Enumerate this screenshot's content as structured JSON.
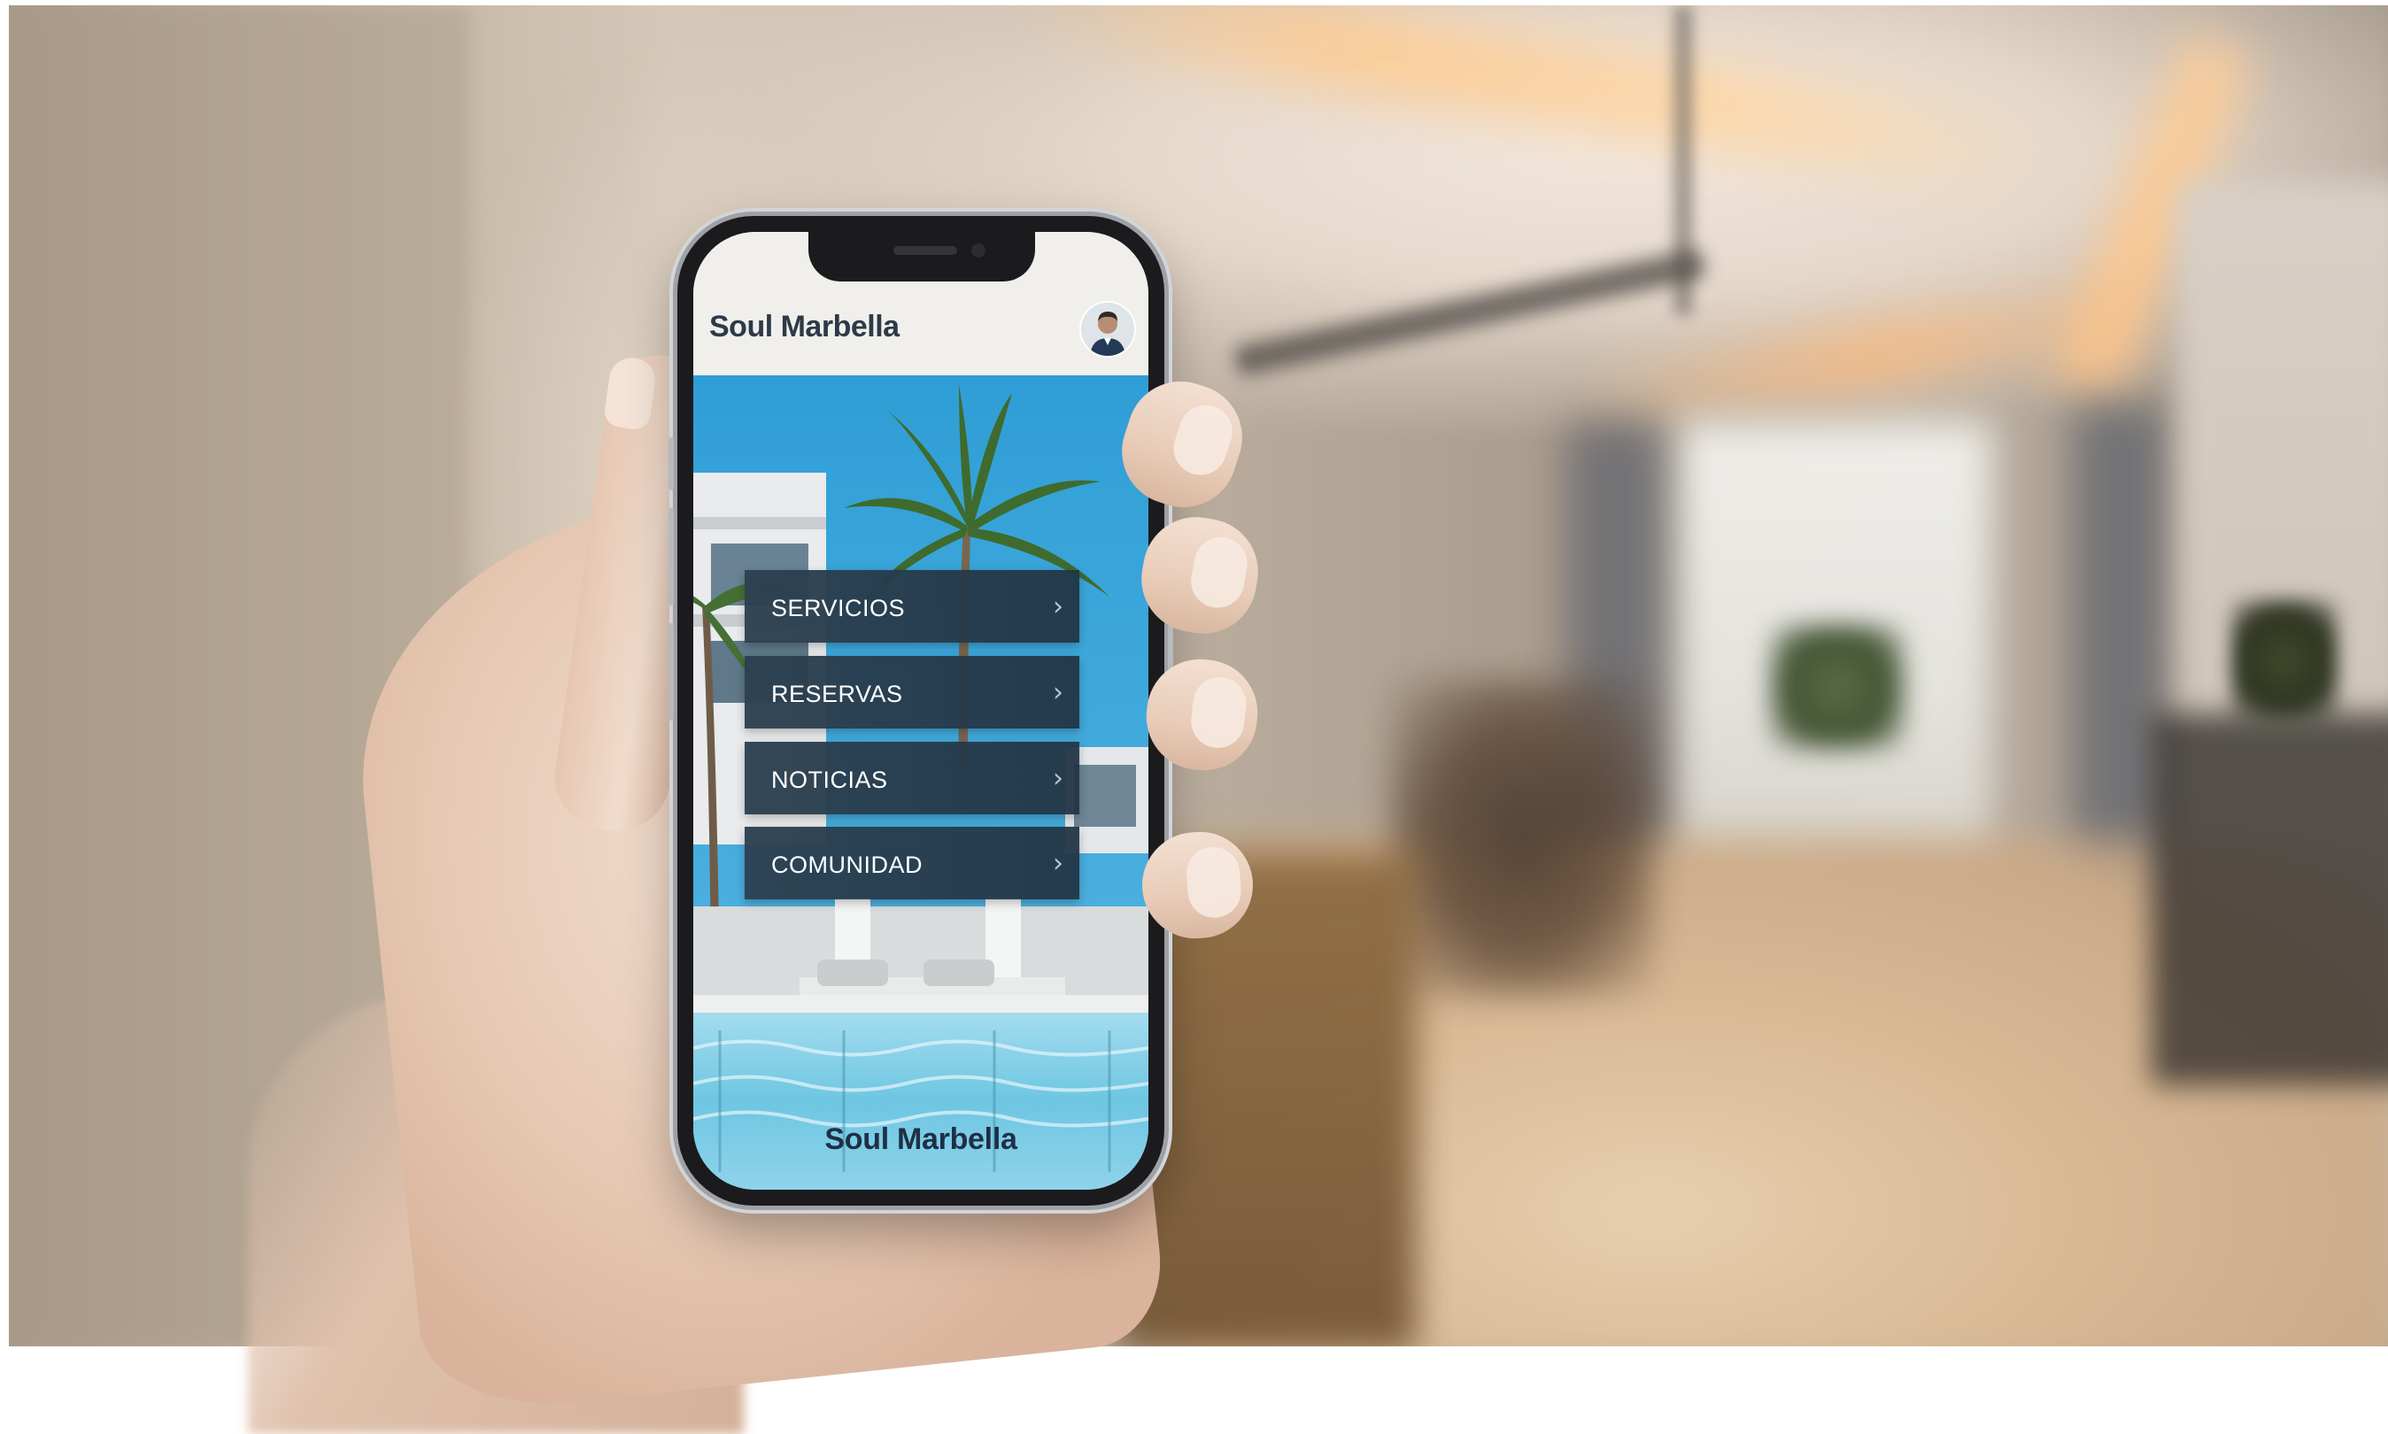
{
  "app": {
    "title": "Soul Marbella",
    "footer_title": "Soul Marbella"
  },
  "menu": {
    "items": [
      {
        "label": "SERVICIOS",
        "icon": "chevron-right-icon"
      },
      {
        "label": "RESERVAS",
        "icon": "chevron-right-icon"
      },
      {
        "label": "NOTICIAS",
        "icon": "chevron-right-icon"
      },
      {
        "label": "COMUNIDAD",
        "icon": "chevron-right-icon"
      }
    ]
  },
  "icons": {
    "chevron": "›",
    "avatar": "user-avatar-icon"
  },
  "colors": {
    "header_text": "#2e3a47",
    "menu_bg": "#2c4050",
    "menu_text": "#ffffff",
    "footer_text": "#1f2f45",
    "sky": "#3aa3d6",
    "pool": "#7fd0e8"
  }
}
